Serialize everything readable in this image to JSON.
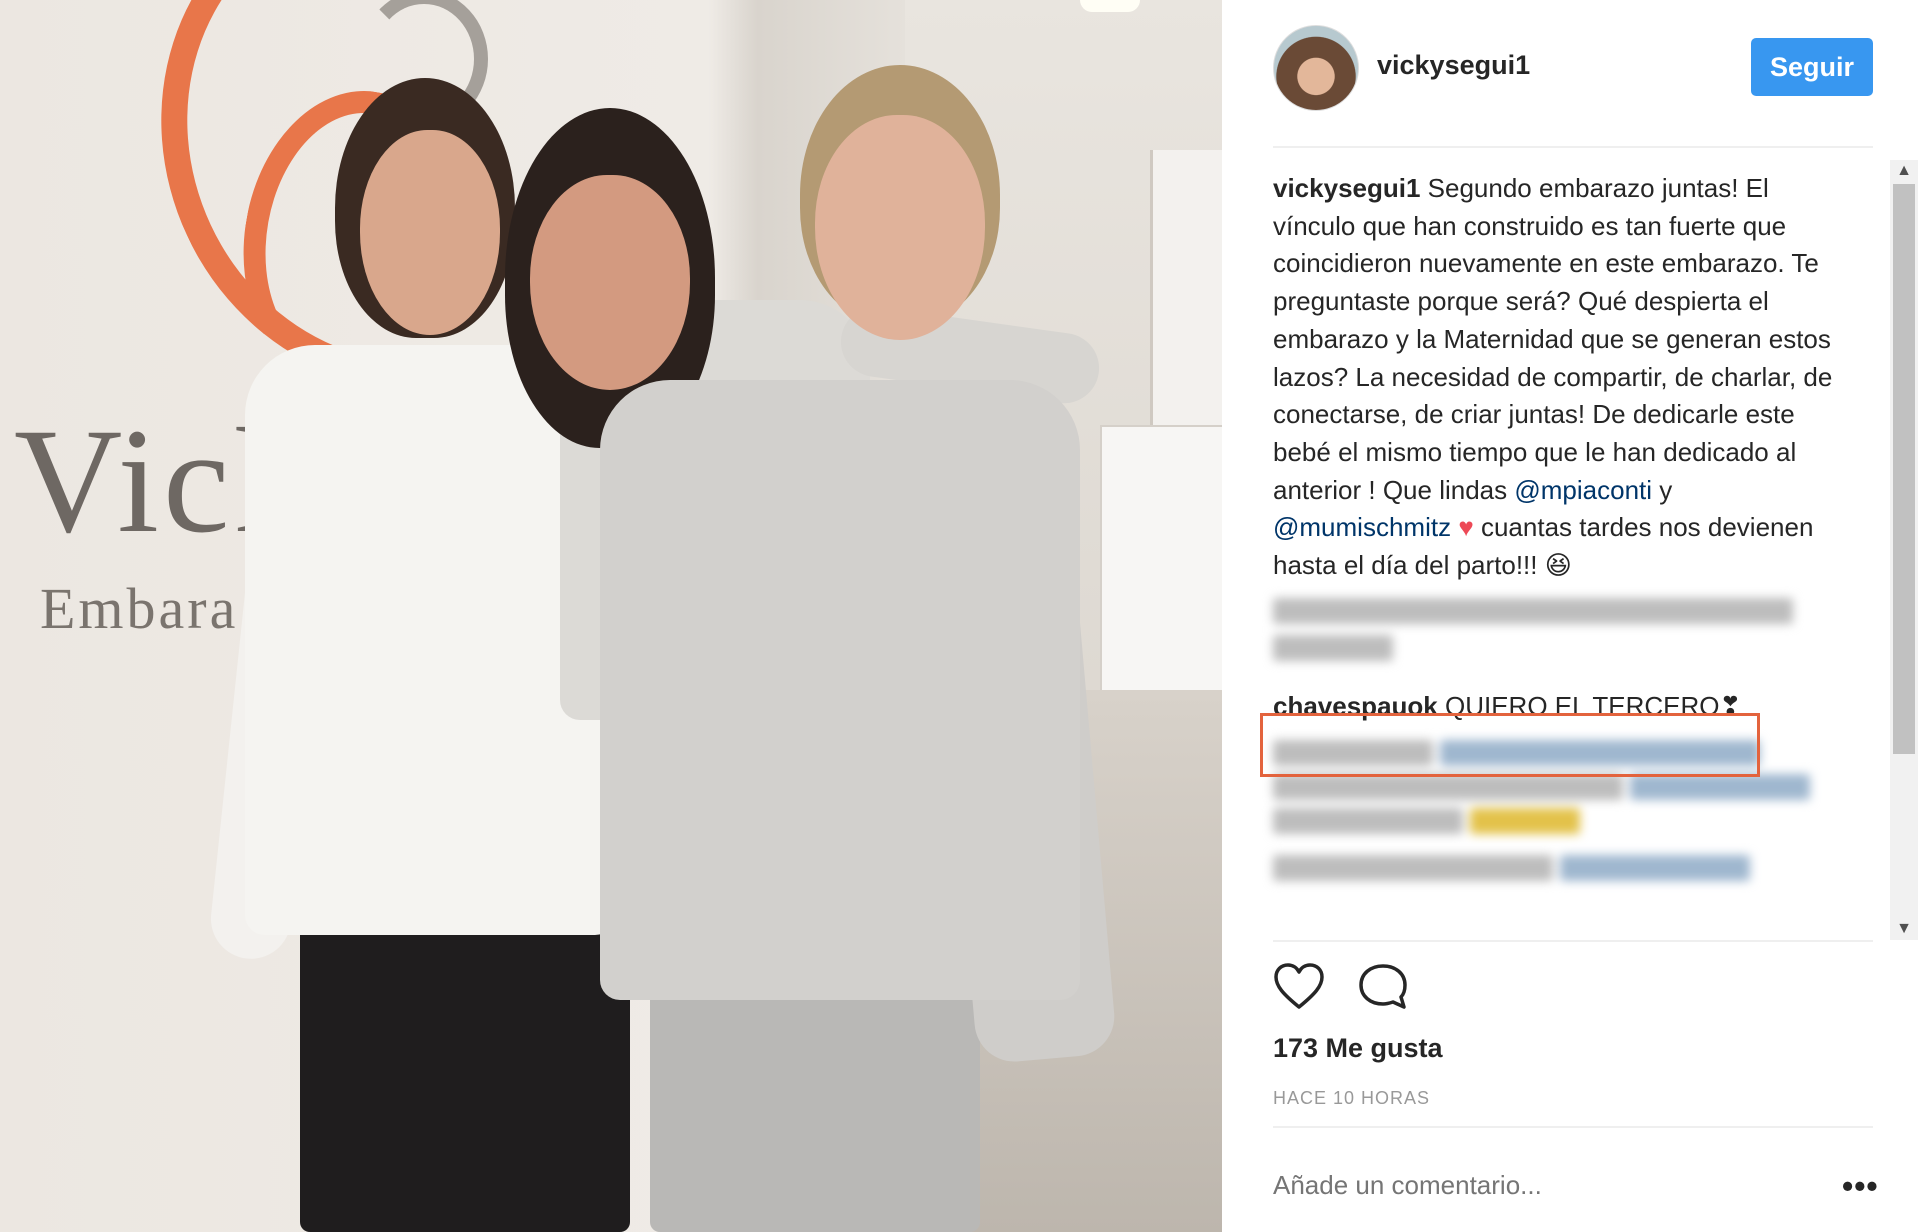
{
  "photo": {
    "brand_big": "Vick",
    "brand_small": "Embara"
  },
  "header": {
    "username": "vickysegui1",
    "follow_label": "Seguir"
  },
  "caption": {
    "user": "vickysegui1",
    "text_1": " Segundo embarazo juntas! El vínculo que han construido es tan fuerte que coincidieron nuevamente en este embarazo. Te preguntaste porque será? Qué despierta el embarazo y la Maternidad que se generan estos lazos? La necesidad de compartir, de charlar, de conectarse, de criar juntas! De dedicarle este bebé el mismo tiempo que le han dedicado al anterior ! Que lindas ",
    "mention_1": "@mpiaconti",
    "text_2": " y ",
    "mention_2": "@mumischmitz",
    "heart": "♥",
    "text_3": " cuantas tardes nos devienen hasta el día del parto!!! ",
    "emoji": "😆"
  },
  "highlighted_comment": {
    "user": "chavespauok",
    "text": "QUIERO EL TERCERO❣"
  },
  "post": {
    "likes": "173 Me gusta",
    "time": "HACE 10 HORAS",
    "comment_placeholder": "Añade un comentario...",
    "more_label": "•••"
  },
  "icons": [
    "heart-outline-icon",
    "comment-bubble-icon",
    "scroll-up-arrow-icon",
    "scroll-down-arrow-icon"
  ],
  "colors": {
    "follow_button": "#3897f0",
    "mention": "#003569",
    "highlight_border": "#e3633d",
    "heart": "#ed4956"
  }
}
